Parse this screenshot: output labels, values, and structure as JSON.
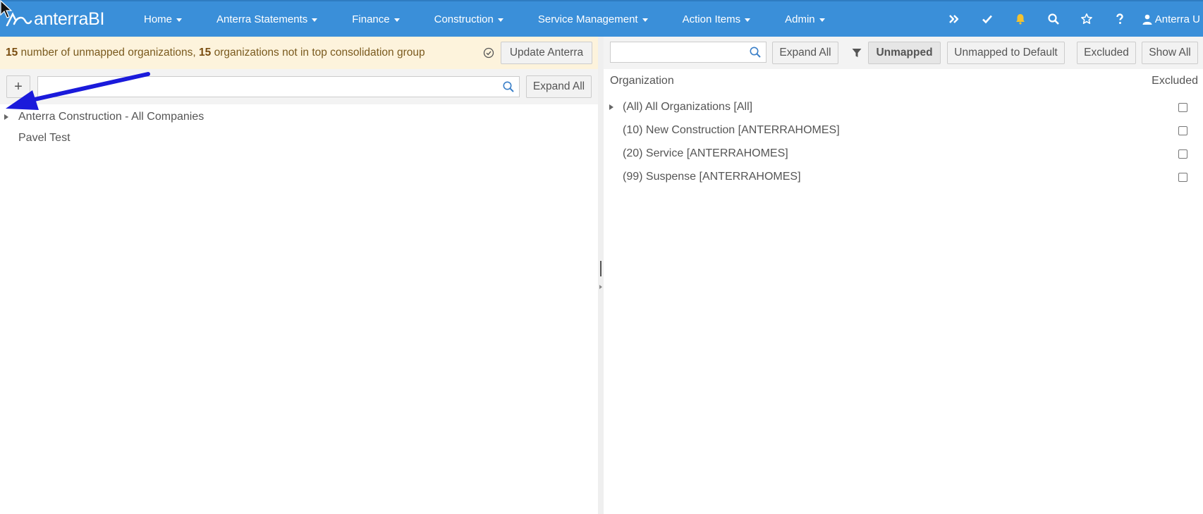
{
  "brand": {
    "name": "anterraBI"
  },
  "nav": {
    "menus": [
      {
        "label": "Home"
      },
      {
        "label": "Anterra Statements"
      },
      {
        "label": "Finance"
      },
      {
        "label": "Construction"
      },
      {
        "label": "Service Management"
      },
      {
        "label": "Action Items"
      },
      {
        "label": "Admin"
      }
    ],
    "user": "Anterra U",
    "icons": [
      "double-chevron-right-icon",
      "check-icon",
      "bell-icon",
      "search-icon",
      "star-icon",
      "question-icon",
      "user-icon"
    ],
    "bell_color": "#f3c230"
  },
  "left": {
    "alert": {
      "count1": "15",
      "text1": " number of unmapped organizations, ",
      "count2": "15",
      "text2": " organizations not in top consolidation group"
    },
    "update_button": "Update Anterra",
    "add_button": "+",
    "search_placeholder": "",
    "expand_all": "Expand All",
    "tree": [
      {
        "label": "Anterra Construction - All Companies",
        "has_children": true
      },
      {
        "label": "Pavel Test",
        "has_children": false
      }
    ]
  },
  "right": {
    "search_placeholder": "",
    "expand_all": "Expand All",
    "filters": {
      "unmapped": "Unmapped",
      "unmapped_default": "Unmapped to Default",
      "excluded": "Excluded",
      "show_all": "Show All"
    },
    "columns": {
      "organization": "Organization",
      "excluded": "Excluded"
    },
    "rows": [
      {
        "label": "(All) All Organizations [All]",
        "has_children": true,
        "excluded": false
      },
      {
        "label": "(10) New Construction [ANTERRAHOMES]",
        "has_children": false,
        "excluded": false
      },
      {
        "label": "(20) Service [ANTERRAHOMES]",
        "has_children": false,
        "excluded": false
      },
      {
        "label": "(99) Suspense [ANTERRAHOMES]",
        "has_children": false,
        "excluded": false
      }
    ]
  },
  "colors": {
    "navbar": "#3a8fd9",
    "alert_bg": "#fdf3dc",
    "annotation_arrow": "#1a1adb"
  }
}
